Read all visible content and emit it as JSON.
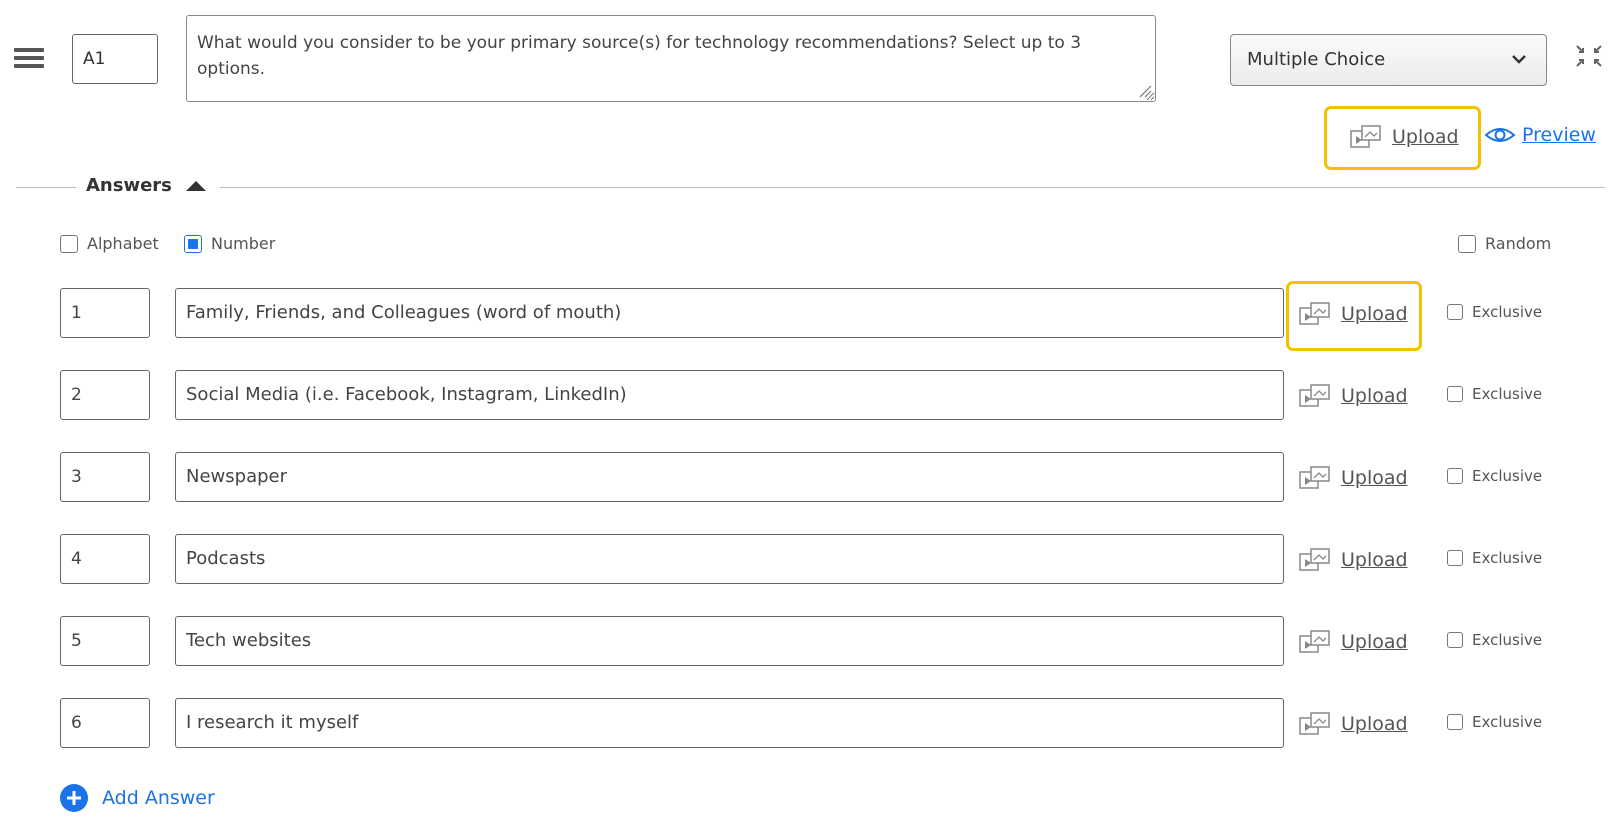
{
  "question": {
    "id": "A1",
    "text": "What would you consider to be your primary source(s) for technology recommendations? Select up to 3 options.",
    "type": "Multiple Choice"
  },
  "toolbar": {
    "upload_label": "Upload",
    "preview_label": "Preview"
  },
  "answers_section": {
    "title": "Answers",
    "alphabet_label": "Alphabet",
    "number_label": "Number",
    "random_label": "Random",
    "numbering_selected": "Number"
  },
  "answers": [
    {
      "num": "1",
      "text": "Family, Friends, and Colleagues (word of mouth)",
      "upload": "Upload",
      "exclusive": "Exclusive"
    },
    {
      "num": "2",
      "text": "Social Media (i.e. Facebook, Instagram, LinkedIn)",
      "upload": "Upload",
      "exclusive": "Exclusive"
    },
    {
      "num": "3",
      "text": "Newspaper",
      "upload": "Upload",
      "exclusive": "Exclusive"
    },
    {
      "num": "4",
      "text": "Podcasts",
      "upload": "Upload",
      "exclusive": "Exclusive"
    },
    {
      "num": "5",
      "text": "Tech websites",
      "upload": "Upload",
      "exclusive": "Exclusive"
    },
    {
      "num": "6",
      "text": "I research it myself",
      "upload": "Upload",
      "exclusive": "Exclusive"
    }
  ],
  "add_answer_label": "Add Answer",
  "colors": {
    "accent": "#1a73e8",
    "highlight": "#f2c200"
  }
}
